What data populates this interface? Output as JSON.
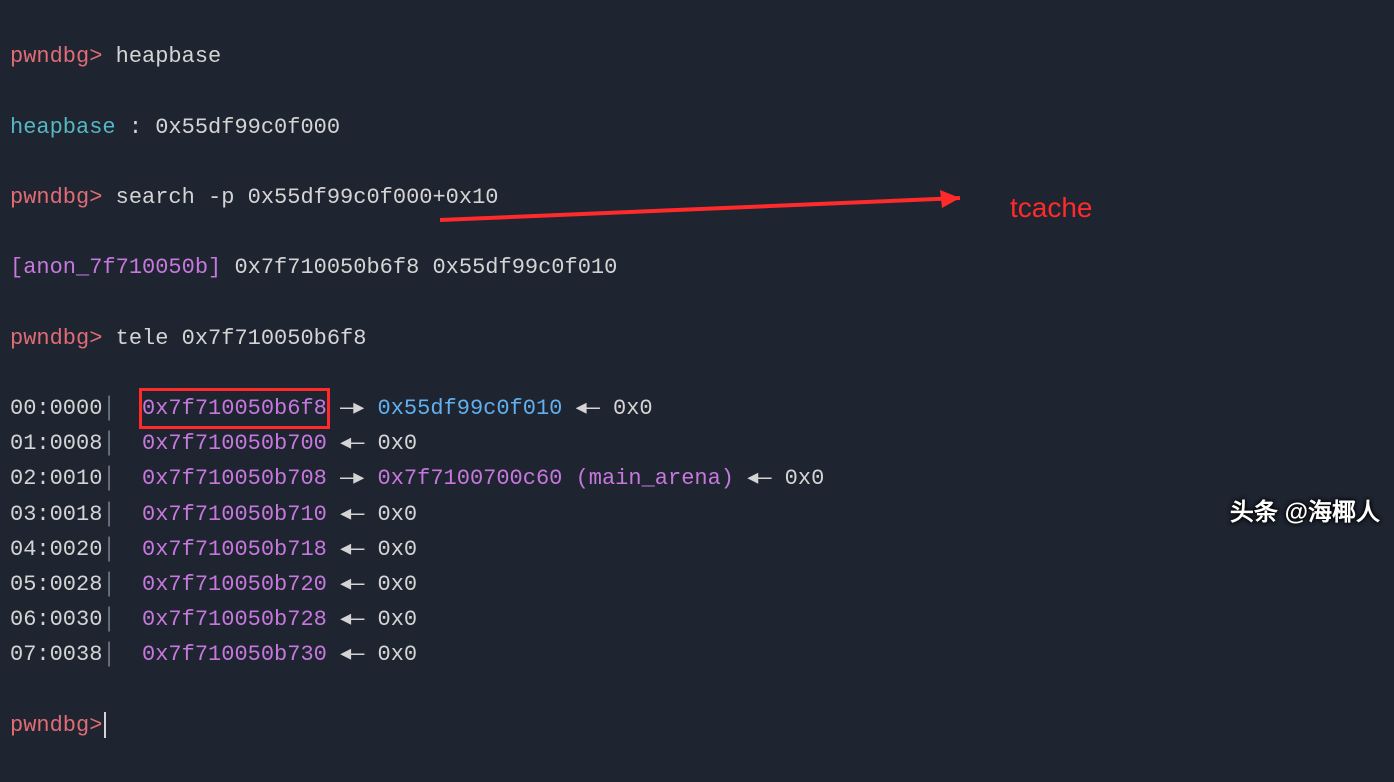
{
  "prompt": "pwndbg>",
  "cmd1": "heapbase",
  "heapbase_label": "heapbase",
  "heapbase_sep": " : ",
  "heapbase_val": "0x55df99c0f000",
  "cmd2": "search -p 0x55df99c0f000+0x10",
  "anon_label": "[anon_7f710050b]",
  "anon_addr": "0x7f710050b6f8",
  "anon_val": "0x55df99c0f010",
  "cmd3": "tele 0x7f710050b6f8",
  "annotation": "tcache",
  "watermark": "头条 @海椰人",
  "tele": [
    {
      "idx": "00",
      "off": "0000",
      "addr": "0x7f710050b6f8",
      "chain": [
        {
          "arrow": "—▸",
          "val": "0x55df99c0f010",
          "cls": "blue"
        },
        {
          "arrow": "◂—",
          "val": "0x0",
          "cls": "white"
        }
      ],
      "hl": true
    },
    {
      "idx": "01",
      "off": "0008",
      "addr": "0x7f710050b700",
      "chain": [
        {
          "arrow": "◂—",
          "val": "0x0",
          "cls": "white"
        }
      ]
    },
    {
      "idx": "02",
      "off": "0010",
      "addr": "0x7f710050b708",
      "chain": [
        {
          "arrow": "—▸",
          "val": "0x7f7100700c60",
          "note": "(main_arena)",
          "cls": "magenta"
        },
        {
          "arrow": "◂—",
          "val": "0x0",
          "cls": "white"
        }
      ]
    },
    {
      "idx": "03",
      "off": "0018",
      "addr": "0x7f710050b710",
      "chain": [
        {
          "arrow": "◂—",
          "val": "0x0",
          "cls": "white"
        }
      ]
    },
    {
      "idx": "04",
      "off": "0020",
      "addr": "0x7f710050b718",
      "chain": [
        {
          "arrow": "◂—",
          "val": "0x0",
          "cls": "white"
        }
      ]
    },
    {
      "idx": "05",
      "off": "0028",
      "addr": "0x7f710050b720",
      "chain": [
        {
          "arrow": "◂—",
          "val": "0x0",
          "cls": "white"
        }
      ]
    },
    {
      "idx": "06",
      "off": "0030",
      "addr": "0x7f710050b728",
      "chain": [
        {
          "arrow": "◂—",
          "val": "0x0",
          "cls": "white"
        }
      ]
    },
    {
      "idx": "07",
      "off": "0038",
      "addr": "0x7f710050b730",
      "chain": [
        {
          "arrow": "◂—",
          "val": "0x0",
          "cls": "white"
        }
      ]
    }
  ]
}
